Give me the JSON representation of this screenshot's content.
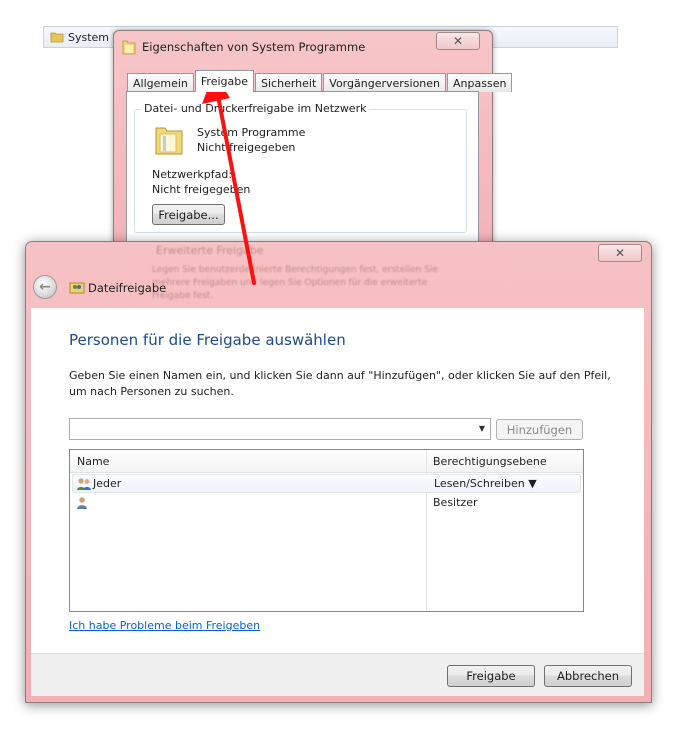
{
  "background": {
    "path_text": "System P..."
  },
  "properties": {
    "title": "Eigenschaften von System Programme",
    "close_glyph": "✕",
    "tabs": [
      "Allgemein",
      "Freigabe",
      "Sicherheit",
      "Vorgängerversionen",
      "Anpassen"
    ],
    "active_tab": "Freigabe",
    "group_label": "Datei- und Druckerfreigabe im Netzwerk",
    "folder_name": "System Programme",
    "folder_status": "Nicht freigegeben",
    "network_path_label": "Netzwerkpfad:",
    "network_path_value": "Nicht freigegeben",
    "share_button": "Freigabe...",
    "blurred_line1": "Erweiterte Freigabe",
    "blurred_line2": "Legen Sie benutzerdefinierte Berechtigungen fest, erstellen Sie",
    "blurred_line3": "mehrere Freigaben und legen Sie Optionen für die erweiterte",
    "blurred_line4": "Freigabe fest."
  },
  "dialog": {
    "close_glyph": "✕",
    "back_glyph": "←",
    "title": "Dateifreigabe",
    "heading": "Personen für die Freigabe auswählen",
    "instructions": "Geben Sie einen Namen ein, und klicken Sie dann auf \"Hinzufügen\", oder klicken Sie auf den Pfeil, um nach Personen zu suchen.",
    "name_input_value": "",
    "add_button": "Hinzufügen",
    "columns": {
      "name": "Name",
      "permission": "Berechtigungsebene"
    },
    "rows": [
      {
        "name": "Jeder",
        "permission": "Lesen/Schreiben ▼"
      },
      {
        "name": "",
        "permission": "Besitzer"
      }
    ],
    "help_link": "Ich habe Probleme beim Freigeben",
    "share_button": "Freigabe",
    "cancel_button": "Abbrechen"
  },
  "colors": {
    "glass": "#f3b5b9",
    "heading": "#1e4a8c",
    "link": "#0066cc",
    "annotation_arrow": "#ff0000"
  },
  "icons": [
    "folder-icon",
    "close-icon",
    "back-arrow-icon",
    "homegroup-icon",
    "users-icon",
    "user-icon",
    "dropdown-arrow-icon",
    "annotation-arrow"
  ]
}
